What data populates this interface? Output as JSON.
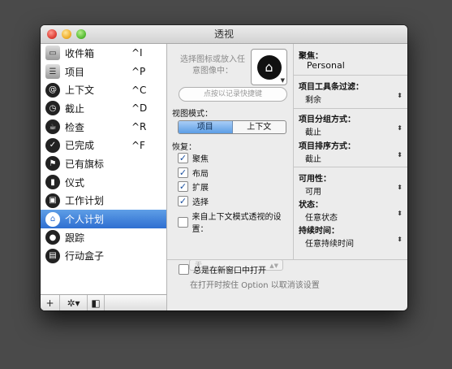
{
  "window": {
    "title": "透视"
  },
  "sidebar": {
    "items": [
      {
        "label": "收件箱",
        "shortcut": "^I",
        "icon": "inbox-icon",
        "glyph": "▭"
      },
      {
        "label": "项目",
        "shortcut": "^P",
        "icon": "projects-icon",
        "glyph": "☰"
      },
      {
        "label": "上下文",
        "shortcut": "^C",
        "icon": "contexts-icon",
        "glyph": "@"
      },
      {
        "label": "截止",
        "shortcut": "^D",
        "icon": "due-icon",
        "glyph": "◷"
      },
      {
        "label": "检查",
        "shortcut": "^R",
        "icon": "review-icon",
        "glyph": "☕"
      },
      {
        "label": "已完成",
        "shortcut": "^F",
        "icon": "completed-icon",
        "glyph": "✓"
      },
      {
        "label": "已有旗标",
        "shortcut": "",
        "icon": "flagged-icon",
        "glyph": "⚑"
      },
      {
        "label": "仪式",
        "shortcut": "",
        "icon": "dashboard-icon",
        "glyph": "▮"
      },
      {
        "label": "工作计划",
        "shortcut": "",
        "icon": "briefcase-icon",
        "glyph": "▣"
      },
      {
        "label": "个人计划",
        "shortcut": "",
        "icon": "home-icon",
        "glyph": "⌂",
        "selected": true
      },
      {
        "label": "跟踪",
        "shortcut": "",
        "icon": "people-icon",
        "glyph": "●"
      },
      {
        "label": "行动盒子",
        "shortcut": "",
        "icon": "box-icon",
        "glyph": "▤"
      }
    ],
    "toolbar": {
      "add": "+",
      "gear": "✲▾",
      "collapse": "◧"
    }
  },
  "middle": {
    "icon_hint": "选择图标或放入任意图像中：",
    "icon_glyph": "⌂",
    "shortcut_button": "点按以记录快捷键",
    "view_mode_label": "视图模式：",
    "view_mode_options": [
      "项目",
      "上下文"
    ],
    "restore_label": "恢复：",
    "restore_items": [
      {
        "label": "聚焦",
        "checked": true
      },
      {
        "label": "布局",
        "checked": true
      },
      {
        "label": "扩展",
        "checked": true
      },
      {
        "label": "选择",
        "checked": true
      },
      {
        "label": "来自上下文模式透视的设置：",
        "checked": false
      }
    ],
    "context_popup": "无",
    "new_window_label": "总是在新窗口中打开",
    "new_window_hint": "在打开时按住 Option 以取消该设置"
  },
  "right": {
    "focus_label": "聚焦：",
    "focus_value": "Personal",
    "toolbar_filter_label": "项目工具条过滤：",
    "toolbar_filter_value": "剩余",
    "grouping_label": "项目分组方式：",
    "grouping_value": "截止",
    "sorting_label": "项目排序方式：",
    "sorting_value": "截止",
    "availability_label": "可用性：",
    "availability_value": "可用",
    "status_label": "状态：",
    "status_value": "任意状态",
    "duration_label": "持续时间：",
    "duration_value": "任意持续时间"
  }
}
